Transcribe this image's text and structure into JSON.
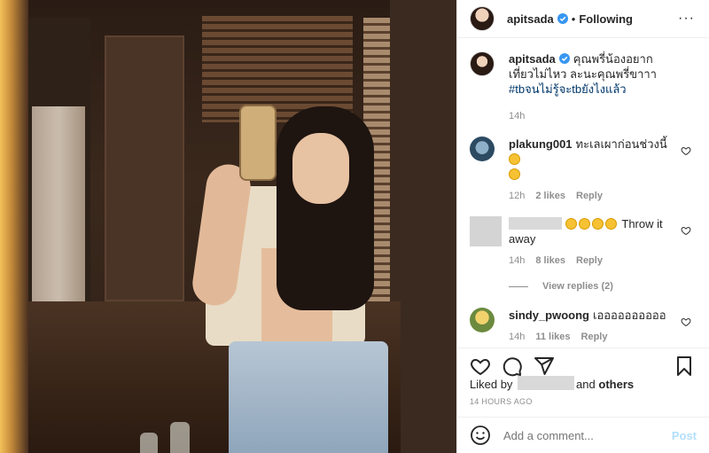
{
  "header": {
    "username": "apitsada",
    "separator": "•",
    "follow_status": "Following",
    "more": "···"
  },
  "caption": {
    "username": "apitsada",
    "text": "คุณพรี่น้องอยากเที่ยวไม่ไหว ละนะคุณพรี่ขาาา",
    "hashtag": "#tbจนไม่รู้จะtbยังไงแล้ว",
    "age": "14h"
  },
  "comments": [
    {
      "username": "plakung001",
      "text": "ทะเลเผาก่อนช่วงนี้",
      "age": "12h",
      "likes": "2 likes",
      "reply": "Reply"
    },
    {
      "username": "",
      "text": "Throw it away",
      "age": "14h",
      "likes": "8 likes",
      "reply": "Reply",
      "view_replies": "View replies (2)"
    },
    {
      "username": "sindy_pwoong",
      "text": "เออออออออออ",
      "age": "14h",
      "likes": "11 likes",
      "reply": "Reply"
    }
  ],
  "likes": {
    "prefix": "Liked by",
    "conjunction": "and",
    "others": "others"
  },
  "timestamp": "14 HOURS AGO",
  "comment_box": {
    "placeholder": "Add a comment...",
    "post": "Post"
  },
  "colors": {
    "verified": "#3897f0",
    "link": "#00376b",
    "muted": "#8e8e8e",
    "post_disabled": "#b2dffc"
  },
  "icons": [
    "verified-icon",
    "more-icon",
    "heart-icon",
    "comment-icon",
    "share-icon",
    "bookmark-icon",
    "emoji-icon"
  ]
}
